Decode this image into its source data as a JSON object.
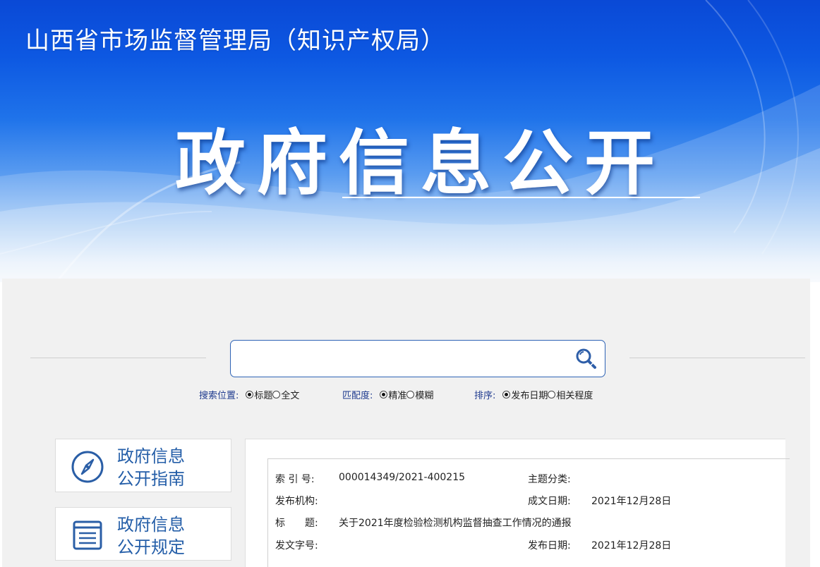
{
  "header": {
    "site_title": "山西省市场监督管理局（知识产权局）",
    "hero_title": "政府信息公开"
  },
  "search": {
    "placeholder": "",
    "value": "",
    "button_icon": "search-icon",
    "options": {
      "position": {
        "label": "搜索位置:",
        "items": [
          {
            "label": "标题",
            "selected": true
          },
          {
            "label": "全文",
            "selected": false
          }
        ]
      },
      "match": {
        "label": "匹配度:",
        "items": [
          {
            "label": "精准",
            "selected": true
          },
          {
            "label": "模糊",
            "selected": false
          }
        ]
      },
      "sort": {
        "label": "排序:",
        "items": [
          {
            "label": "发布日期",
            "selected": true
          },
          {
            "label": "相关程度",
            "selected": false
          }
        ]
      }
    }
  },
  "sidebar": {
    "items": [
      {
        "line1": "政府信息",
        "line2": "公开指南",
        "icon": "compass-icon"
      },
      {
        "line1": "政府信息",
        "line2": "公开规定",
        "icon": "document-list-icon"
      }
    ]
  },
  "doc_info": {
    "index_label": "索 引 号:",
    "index_value": "000014349/2021-400215",
    "topic_label": "主题分类:",
    "topic_value": "",
    "publisher_label": "发布机构:",
    "publisher_value": "",
    "written_date_label": "成文日期:",
    "written_date_value": "2021年12月28日",
    "title_label": "标　　题:",
    "title_value": "关于2021年度检验检测机构监督抽查工作情况的通报",
    "doc_number_label": "发文字号:",
    "doc_number_value": "",
    "publish_date_label": "发布日期:",
    "publish_date_value": "2021年12月28日"
  },
  "colors": {
    "banner_top": "#0a49d6",
    "accent_blue": "#245ea8",
    "option_label": "#1f3b8f",
    "search_border": "#2e63b5"
  }
}
